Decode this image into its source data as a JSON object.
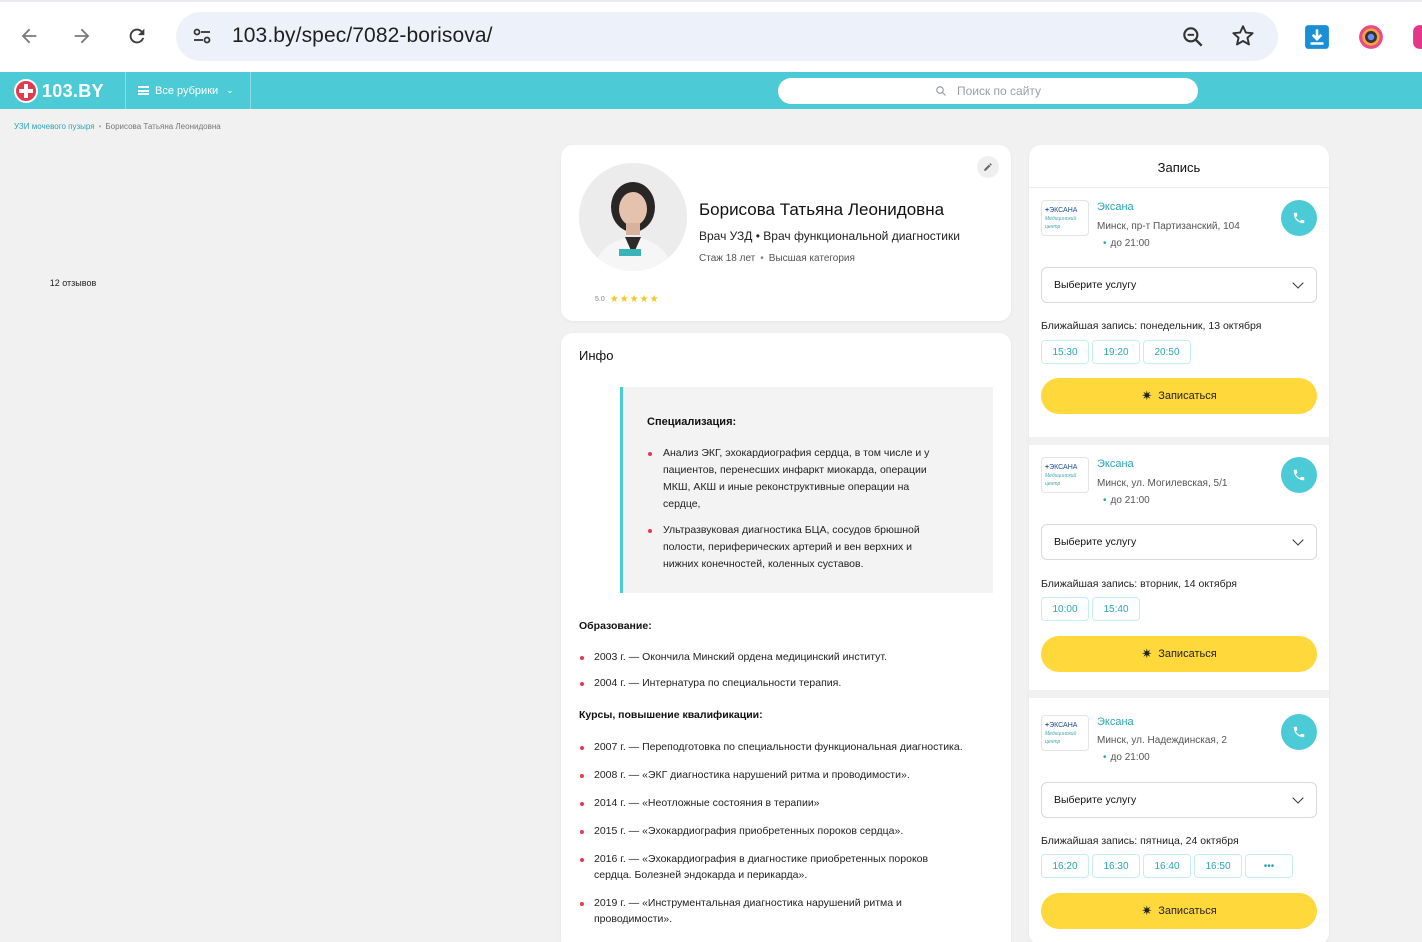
{
  "browser": {
    "url": "103.by/spec/7082-borisova/"
  },
  "header": {
    "logo_text": "103.BY",
    "rubrics_label": "Все рубрики",
    "search_placeholder": "Поиск по сайту"
  },
  "breadcrumb": {
    "items": [
      "УЗИ мочевого пузыря",
      "Борисова Татьяна Леонидовна"
    ]
  },
  "doctor": {
    "name": "Борисова Татьяна Леонидовна",
    "specialties": "Врач УЗД • Врач функциональной диагностики",
    "experience": "Стаж 18 лет",
    "category": "Высшая категория",
    "reviews": "12 отзывов",
    "rating": "5.0",
    "stars": "★★★★★"
  },
  "info": {
    "title": "Инфо",
    "specialization_title": "Специализация:",
    "specialization": [
      "Анализ ЭКГ, эхокардиография сердца, в том числе и у пациентов, перенесших инфаркт миокарда, операции МКШ, АКШ и иные реконструктивные операции на сердце,",
      "Ультразвуковая диагностика БЦА, сосудов брюшной полости, периферических артерий и вен верхних и нижних конечностей, коленных суставов."
    ],
    "education_title": "Образование:",
    "education": [
      "2003 г. — Окончила Минский ордена медицинский институт.",
      "2004 г. — Интернатура по специальности терапия."
    ],
    "courses_title": "Курсы, повышение квалификации:",
    "courses": [
      "2007 г. — Переподготовка по специальности функциональная диагностика.",
      "2008 г. — «ЭКГ диагностика нарушений ритма и проводимости».",
      "2014 г. — «Неотложные состояния в терапии»",
      "2015 г. — «Эхокардиография приобретенных пороков сердца».",
      "2016 г. — «Эхокардиография в диагностике приобретенных пороков сердца. Болезней эндокарда и перикарда».",
      "2019 г. — «Инструментальная диагностика нарушений ритма и проводимости»."
    ]
  },
  "booking": {
    "title": "Запись",
    "logo_text": "ЭКСАНА",
    "logo_subtext": "Медицинский центр",
    "select_placeholder": "Выберите услугу",
    "book_label": "Записаться",
    "clinics": [
      {
        "name": "Эксана",
        "address": "Минск, пр-т Партизанский, 104",
        "hours": "до 21:00",
        "nearest": "Ближайшая запись: понедельник, 13 октября",
        "slots": [
          "15:30",
          "19:20",
          "20:50"
        ]
      },
      {
        "name": "Эксана",
        "address": "Минск, ул. Могилевская, 5/1",
        "hours": "до 21:00",
        "nearest": "Ближайшая запись: вторник, 14 октября",
        "slots": [
          "10:00",
          "15:40"
        ]
      },
      {
        "name": "Эксана",
        "address": "Минск, ул. Надеждинская, 2",
        "hours": "до 21:00",
        "nearest": "Ближайшая запись: пятница, 24 октября",
        "slots": [
          "16:20",
          "16:30",
          "16:40",
          "16:50",
          "•••"
        ]
      }
    ]
  },
  "colors": {
    "accent": "#4ccbd6",
    "link": "#2aa6b5",
    "bullet": "#e23a4e",
    "book_button": "#ffd83b"
  }
}
